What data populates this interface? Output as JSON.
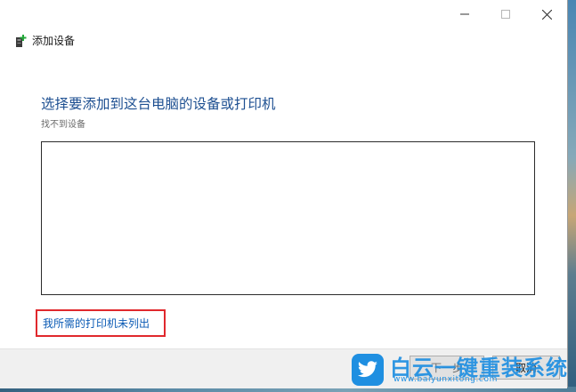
{
  "window": {
    "title": "添加设备",
    "controls": {
      "minimize_icon": "minimize-icon",
      "maximize_icon": "maximize-icon",
      "close_icon": "close-icon"
    }
  },
  "main": {
    "heading": "选择要添加到这台电脑的设备或打印机",
    "status": "找不到设备",
    "device_list_items": [],
    "printer_link": "我所需的打印机未列出",
    "highlight_color": "#e0282d"
  },
  "footer": {
    "next_label": "下一步",
    "cancel_label": "取消"
  },
  "watermark": {
    "title": "白云一键重装系统",
    "url": "www.baiyunxitong.com",
    "brand_color": "#1f8fe1",
    "logo_icon": "twitter-bird-icon"
  }
}
